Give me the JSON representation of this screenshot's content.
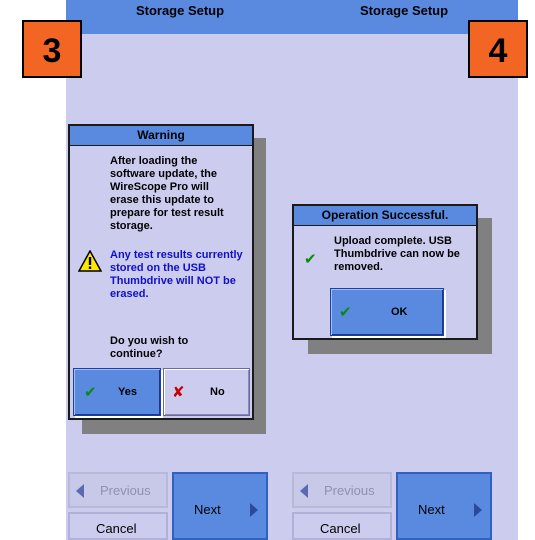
{
  "panel3": {
    "title": "Storage Setup",
    "step": "3",
    "dialog": {
      "title": "Warning",
      "lines": [
        "After loading the",
        "software update, the",
        "WireScope Pro will",
        "erase this update to",
        "prepare for test result",
        "storage."
      ],
      "blue_lines": [
        "Any test results currently",
        "stored on the USB",
        "Thumbdrive will NOT be",
        "erased."
      ],
      "question_lines": [
        "Do you wish to",
        "continue?"
      ],
      "yes_label": "Yes",
      "no_label": "No"
    },
    "nav": {
      "previous": "Previous",
      "next": "Next",
      "cancel": "Cancel"
    }
  },
  "panel4": {
    "title": "Storage Setup",
    "step": "4",
    "dialog": {
      "title": "Operation Successful.",
      "lines": [
        "Upload complete. USB",
        "Thumbdrive can now be",
        "removed."
      ],
      "ok_label": "OK"
    },
    "nav": {
      "previous": "Previous",
      "next": "Next",
      "cancel": "Cancel"
    }
  },
  "colors": {
    "screen_bg": "#ccccee",
    "accent_blue": "#5a8ae0",
    "badge_orange": "#f26522",
    "warning_text": "#1010c8",
    "check_green": "#0a8a0a",
    "x_red": "#c80000"
  },
  "icons": [
    "warning-triangle-icon",
    "check-icon",
    "x-icon",
    "arrow-left-icon",
    "arrow-right-icon"
  ]
}
